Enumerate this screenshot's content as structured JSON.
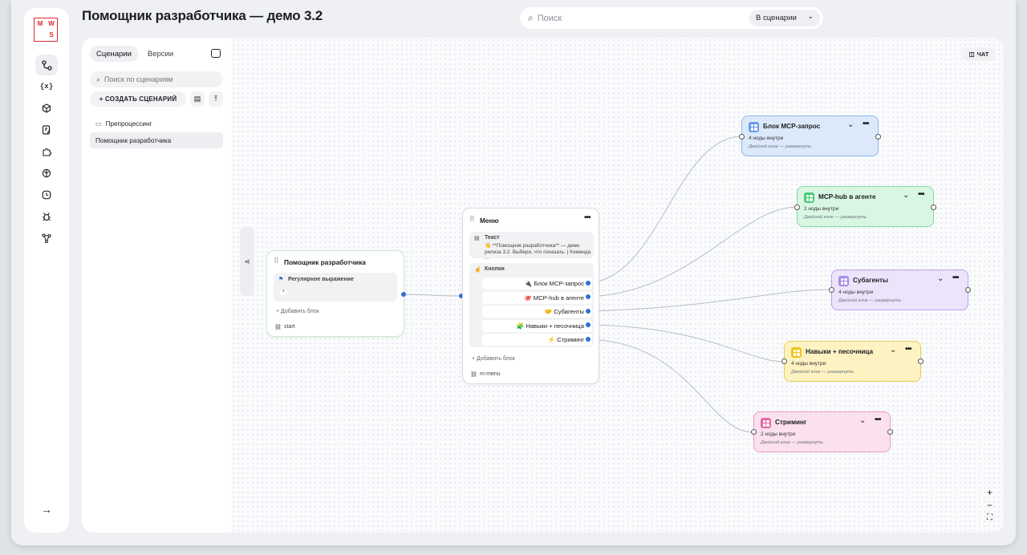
{
  "app": {
    "title": "Помощник разработчика — демо 3.2"
  },
  "logo": {
    "letters": [
      "M",
      "W",
      "S"
    ]
  },
  "top_search": {
    "placeholder": "Поиск",
    "scope": "В сценарии"
  },
  "rail": {
    "icons": [
      "flow-icon",
      "variables-icon",
      "cube-icon",
      "edit-note-icon",
      "plugin-icon",
      "brain-icon",
      "clock-icon",
      "bug-icon",
      "graph-icon"
    ],
    "exit": "→"
  },
  "panel": {
    "tabs": [
      "Сценарии",
      "Версии"
    ],
    "search_placeholder": "Поиск по сценариям",
    "create_label": "+ СОЗДАТЬ СЦЕНАРИЙ",
    "items": [
      "Препроцессинг",
      "Помощник разработчика"
    ]
  },
  "canvas": {
    "chat_label": "ЧАТ"
  },
  "start_node": {
    "title": "Помощник разработчика",
    "block": "Регулярное выражение",
    "block_value": "*",
    "add_block": "+ Добавить блок",
    "footer": "start"
  },
  "menu_node": {
    "title": "Меню",
    "text_label": "Текст",
    "text_line1": "👋 **Помощник разработчика** — демо",
    "text_line2": "релиза 3.2. Выбери, что показать: | Команда ...",
    "buttons_label": "Кнопки",
    "buttons": [
      "🔌 Блок MCP-запрос",
      "🐙 MCP-hub в агенте",
      "🤝 Субагенты",
      "🧩 Навыки + песочница",
      "⚡ Стриминг"
    ],
    "add_block": "+ Добавить блок",
    "footer": "m-menu"
  },
  "groups": [
    {
      "title": "Блок MCP-запрос",
      "sub": "4 ноды внутри",
      "hint": "Двойной клик — развернуть",
      "color": "#dbe9fb",
      "border": "#8fb6ee",
      "icon": "#6c9ce8"
    },
    {
      "title": "MCP-hub в агенте",
      "sub": "2 ноды внутри",
      "hint": "Двойной клик — развернуть",
      "color": "#d9f6e3",
      "border": "#86d9a2",
      "icon": "#4ccb78"
    },
    {
      "title": "Субагенты",
      "sub": "4 ноды внутри",
      "hint": "Двойной клик — развернуть",
      "color": "#ebe4fb",
      "border": "#b9a3ee",
      "icon": "#a98be6"
    },
    {
      "title": "Навыки + песочница",
      "sub": "4 ноды внутри",
      "hint": "Двойной клик — развернуть",
      "color": "#fcf2c2",
      "border": "#e8cf52",
      "icon": "#f2c21a"
    },
    {
      "title": "Стриминг",
      "sub": "2 ноды внутри",
      "hint": "Двойной клик — развернуть",
      "color": "#fbe0ee",
      "border": "#ec9cc6",
      "icon": "#e46aa8"
    }
  ],
  "zoom": {
    "in": "+",
    "out": "−",
    "fit": "⛶"
  }
}
